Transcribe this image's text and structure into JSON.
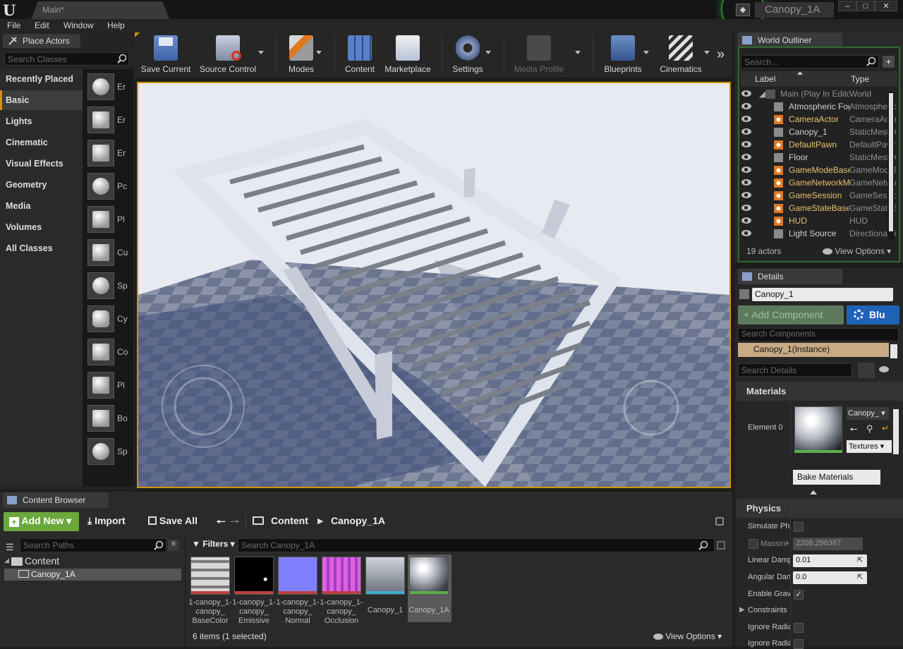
{
  "titlebar": {
    "doc_tab": "Main*",
    "project": "Canopy_1A",
    "win_min": "–",
    "win_max": "□",
    "win_close": "✕"
  },
  "menu": [
    "File",
    "Edit",
    "Window",
    "Help"
  ],
  "place_actors": {
    "tab": "Place Actors",
    "search_placeholder": "Search Classes",
    "categories": [
      "Recently Placed",
      "Basic",
      "Lights",
      "Cinematic",
      "Visual Effects",
      "Geometry",
      "Media",
      "Volumes",
      "All Classes"
    ],
    "active_category": "Basic",
    "item_labels": [
      "Er",
      "Er",
      "Er",
      "Pc",
      "Pl",
      "Cu",
      "Sp",
      "Cy",
      "Co",
      "Pl",
      "Bo",
      "Sp"
    ]
  },
  "toolbar": {
    "save_current": "Save Current",
    "source_control": "Source Control",
    "modes": "Modes",
    "content": "Content",
    "marketplace": "Marketplace",
    "settings": "Settings",
    "media_profile": "Media Profile",
    "blueprints": "Blueprints",
    "cinematics": "Cinematics",
    "more": "»"
  },
  "outliner": {
    "tab": "World Outliner",
    "search_placeholder": "Search...",
    "col_label": "Label",
    "col_type": "Type",
    "root": {
      "label": "Main (Play In Editor)",
      "type": "World"
    },
    "rows": [
      {
        "label": "Atmospheric Fog",
        "type": "AtmosphericFog",
        "color": "#d0d0d0"
      },
      {
        "label": "CameraActor",
        "type": "CameraActor",
        "color": "#e8c070"
      },
      {
        "label": "Canopy_1",
        "type": "StaticMeshActor",
        "color": "#d0d0d0"
      },
      {
        "label": "DefaultPawn",
        "type": "DefaultPawn",
        "color": "#e8c070"
      },
      {
        "label": "Floor",
        "type": "StaticMeshActor",
        "color": "#d0d0d0"
      },
      {
        "label": "GameModeBase",
        "type": "GameModeBase",
        "color": "#e8c070"
      },
      {
        "label": "GameNetworkManager",
        "type": "GameNetworkManager",
        "color": "#e8c070"
      },
      {
        "label": "GameSession",
        "type": "GameSession",
        "color": "#e8c070"
      },
      {
        "label": "GameStateBase",
        "type": "GameStateBase",
        "color": "#e8c070"
      },
      {
        "label": "HUD",
        "type": "HUD",
        "color": "#e8c070"
      },
      {
        "label": "Light Source",
        "type": "DirectionalLight",
        "color": "#d0d0d0"
      }
    ],
    "actor_count": "19 actors",
    "view_options": "View Options"
  },
  "details": {
    "tab": "Details",
    "actor_name": "Canopy_1",
    "add_component": "+ Add Component",
    "blueprint": "Blu",
    "search_components": "Search Components",
    "instance": "Canopy_1(Instance)",
    "search_details": "Search Details",
    "materials_header": "Materials",
    "element0": "Element 0",
    "material_dropdown": "Canopy_",
    "textures": "Textures",
    "bake_materials": "Bake Materials",
    "physics_header": "Physics",
    "simulate": "Simulate Ph",
    "mass": "MassInK",
    "mass_value": "2208.296387",
    "linear_damp": "Linear Damp",
    "linear_value": "0.01",
    "angular_damp": "Angular Dan",
    "angular_value": "0.0",
    "enable_grav": "Enable Grav",
    "constraints": "Constraints",
    "ignore1": "Ignore Radia",
    "ignore2": "Ignore Radia"
  },
  "content_browser": {
    "tab": "Content Browser",
    "add_new": "Add New",
    "import": "Import",
    "save_all": "Save All",
    "crumb_root": "Content",
    "crumb_folder": "Canopy_1A",
    "search_paths": "Search Paths",
    "filters": "Filters",
    "search_assets": "Search Canopy_1A",
    "tree_root": "Content",
    "tree_child": "Canopy_1A",
    "assets": [
      {
        "label": "1-canopy_1-canopy_BaseColor",
        "line1": "1-canopy_1-",
        "line2": "canopy_",
        "line3": "BaseColor",
        "bar": "#c04040"
      },
      {
        "label": "1-canopy_1-canopy_Emissive",
        "line1": "1-canopy_1-",
        "line2": "canopy_",
        "line3": "Emissive",
        "bar": "#c04040"
      },
      {
        "label": "1-canopy_1-canopy_Normal",
        "line1": "1-canopy_1-",
        "line2": "canopy_",
        "line3": "Normal",
        "bar": "#c04040"
      },
      {
        "label": "1-canopy_1-canopy_Occlusion",
        "line1": "1-canopy_1-",
        "line2": "canopy_",
        "line3": "Occlusion",
        "bar": "#c04040"
      },
      {
        "label": "Canopy_1",
        "line1": "Canopy_1",
        "line2": "",
        "line3": "",
        "bar": "#3fb0d0"
      },
      {
        "label": "Canopy_1A",
        "line1": "Canopy_1A",
        "line2": "",
        "line3": "",
        "bar": "#5bb04a"
      }
    ],
    "status": "6 items (1 selected)",
    "view_options": "View Options"
  }
}
